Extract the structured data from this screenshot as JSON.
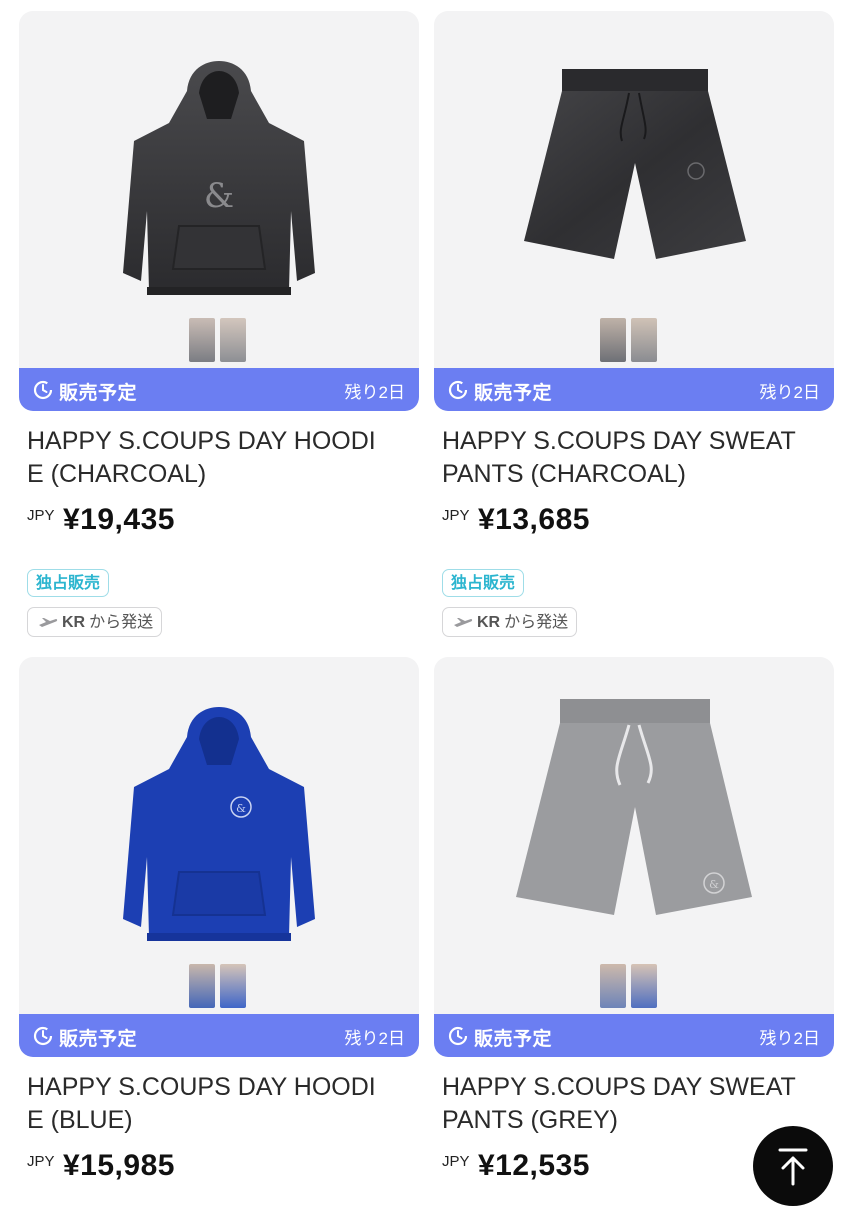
{
  "products": [
    {
      "name": "HAPPY S.COUPS DAY HOODIE (CHARCOAL)",
      "title_line1": "HAPPY S.COUPS DAY HOODI",
      "title_line2": "E (CHARCOAL)",
      "currency": "JPY",
      "price": "¥19,435",
      "status_label": "販売予定",
      "remaining": "残り2日",
      "tag_exclusive": "独占販売",
      "ship_country": "KR",
      "ship_suffix": "から発送",
      "color": "#3a3a3c",
      "item_type": "hoodie",
      "thumb_colors": [
        "#7b7d83",
        "#8d8f94"
      ]
    },
    {
      "name": "HAPPY S.COUPS DAY SWEAT PANTS (CHARCOAL)",
      "title_line1": "HAPPY S.COUPS DAY SWEAT",
      "title_line2": "PANTS (CHARCOAL)",
      "currency": "JPY",
      "price": "¥13,685",
      "status_label": "販売予定",
      "remaining": "残り2日",
      "tag_exclusive": "独占販売",
      "ship_country": "KR",
      "ship_suffix": "から発送",
      "color": "#38383b",
      "item_type": "shorts",
      "thumb_colors": [
        "#6e7076",
        "#8a8c91"
      ]
    },
    {
      "name": "HAPPY S.COUPS DAY HOODIE (BLUE)",
      "title_line1": "HAPPY S.COUPS DAY HOODI",
      "title_line2": "E (BLUE)",
      "currency": "JPY",
      "price": "¥15,985",
      "status_label": "販売予定",
      "remaining": "残り2日",
      "color": "#1c3fb3",
      "item_type": "hoodie",
      "thumb_colors": [
        "#4467b8",
        "#3f66c8"
      ]
    },
    {
      "name": "HAPPY S.COUPS DAY SWEAT PANTS (GREY)",
      "title_line1": "HAPPY S.COUPS DAY SWEAT",
      "title_line2": "PANTS (GREY)",
      "currency": "JPY",
      "price": "¥12,535",
      "status_label": "販売予定",
      "remaining": "残り2日",
      "color": "#9b9c9f",
      "item_type": "shorts",
      "thumb_colors": [
        "#6d84b8",
        "#4f6fc0"
      ]
    }
  ],
  "colors": {
    "banner": "#6b7ef2",
    "exclusive_tag": "#2bb5cf",
    "card_bg": "#f3f3f4",
    "scroll_top_button": "#0b0b0b"
  },
  "icons": {
    "clock": "clock-icon",
    "plane": "plane-icon",
    "scroll_top": "arrow-up-icon"
  }
}
